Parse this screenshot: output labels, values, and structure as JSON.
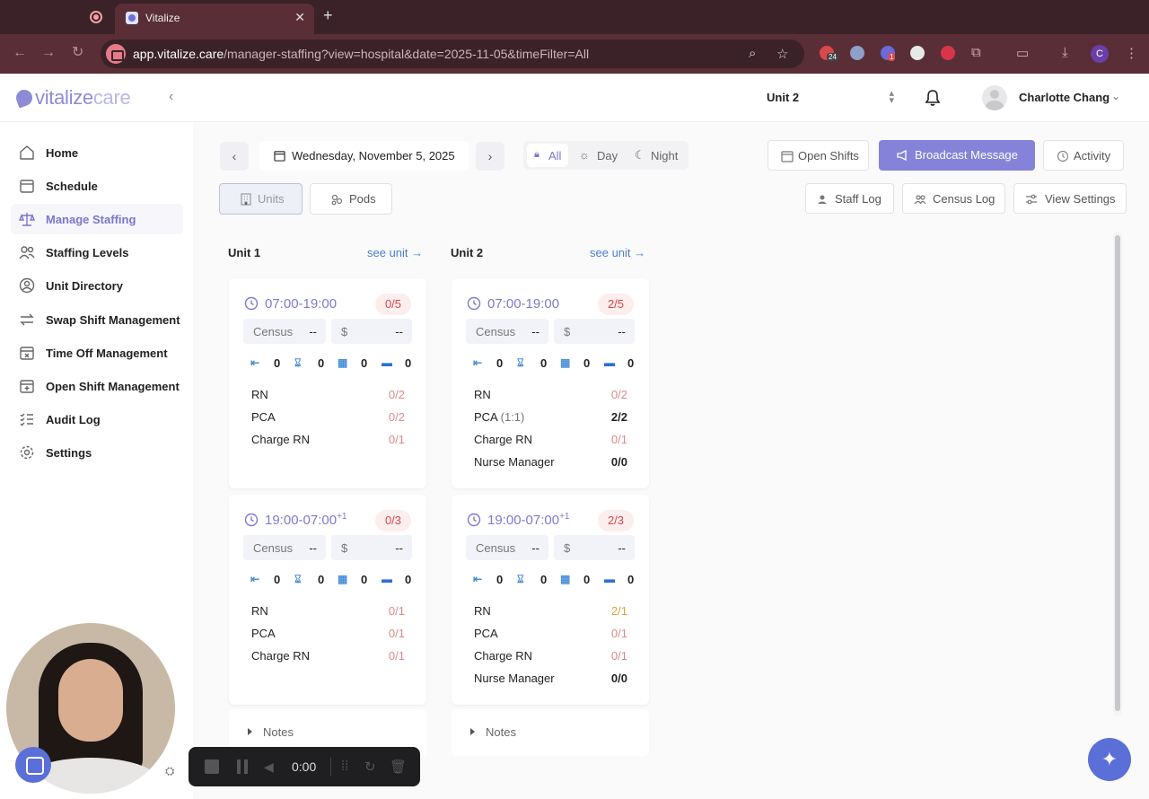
{
  "browser": {
    "tab_title": "Vitalize",
    "url_host": "app.vitalize.care",
    "url_path": "/manager-staffing?view=hospital&date=2025-11-05&timeFilter=All",
    "ext_badge_1": "24",
    "ext_badge_2": "1",
    "profile_letter": "C"
  },
  "header": {
    "logo_vitalize": "vitalize",
    "logo_care": "care",
    "unit_select": "Unit 2",
    "user_name": "Charlotte Chang"
  },
  "sidebar": {
    "items": [
      {
        "label": "Home",
        "icon": "home-icon"
      },
      {
        "label": "Schedule",
        "icon": "calendar-icon"
      },
      {
        "label": "Manage Staffing",
        "icon": "scale-icon"
      },
      {
        "label": "Staffing Levels",
        "icon": "people-icon"
      },
      {
        "label": "Unit Directory",
        "icon": "user-circle-icon"
      },
      {
        "label": "Swap Shift Management",
        "icon": "swap-icon"
      },
      {
        "label": "Time Off Management",
        "icon": "calendar-x-icon"
      },
      {
        "label": "Open Shift Management",
        "icon": "calendar-plus-icon"
      },
      {
        "label": "Audit Log",
        "icon": "list-check-icon"
      },
      {
        "label": "Settings",
        "icon": "gear-icon"
      }
    ],
    "active": "Manage Staffing"
  },
  "toolbar": {
    "date": "Wednesday, November 5, 2025",
    "filters": [
      "All",
      "Day",
      "Night"
    ],
    "active_filter": "All",
    "open_shifts": "Open Shifts",
    "broadcast": "Broadcast Message",
    "activity": "Activity",
    "view_units": "Units",
    "view_pods": "Pods",
    "staff_log": "Staff Log",
    "census_log": "Census Log",
    "view_settings": "View Settings"
  },
  "columns": [
    {
      "title": "Unit 1",
      "see_unit": "see unit →",
      "notes": "Notes",
      "shifts": [
        {
          "time": "07:00-19:00",
          "sup": "",
          "count": "0/5",
          "census_label": "Census",
          "census_value": "--",
          "cost_label": "$",
          "cost_value": "--",
          "stats": [
            "0",
            "0",
            "0",
            "0"
          ],
          "roles": [
            {
              "name": "RN",
              "sub": "",
              "value": "0/2",
              "tone": "red"
            },
            {
              "name": "PCA",
              "sub": "",
              "value": "0/2",
              "tone": "red"
            },
            {
              "name": "Charge RN",
              "sub": "",
              "value": "0/1",
              "tone": "red"
            }
          ]
        },
        {
          "time": "19:00-07:00",
          "sup": "+1",
          "count": "0/3",
          "census_label": "Census",
          "census_value": "--",
          "cost_label": "$",
          "cost_value": "--",
          "stats": [
            "0",
            "0",
            "0",
            "0"
          ],
          "roles": [
            {
              "name": "RN",
              "sub": "",
              "value": "0/1",
              "tone": "red"
            },
            {
              "name": "PCA",
              "sub": "",
              "value": "0/1",
              "tone": "red"
            },
            {
              "name": "Charge RN",
              "sub": "",
              "value": "0/1",
              "tone": "red"
            }
          ]
        }
      ]
    },
    {
      "title": "Unit 2",
      "see_unit": "see unit →",
      "notes": "Notes",
      "shifts": [
        {
          "time": "07:00-19:00",
          "sup": "",
          "count": "2/5",
          "census_label": "Census",
          "census_value": "--",
          "cost_label": "$",
          "cost_value": "--",
          "stats": [
            "0",
            "0",
            "0",
            "0"
          ],
          "roles": [
            {
              "name": "RN",
              "sub": "",
              "value": "0/2",
              "tone": "red"
            },
            {
              "name": "PCA",
              "sub": "(1:1)",
              "value": "2/2",
              "tone": "black"
            },
            {
              "name": "Charge RN",
              "sub": "",
              "value": "0/1",
              "tone": "red"
            },
            {
              "name": "Nurse Manager",
              "sub": "",
              "value": "0/0",
              "tone": "black"
            }
          ]
        },
        {
          "time": "19:00-07:00",
          "sup": "+1",
          "count": "2/3",
          "census_label": "Census",
          "census_value": "--",
          "cost_label": "$",
          "cost_value": "--",
          "stats": [
            "0",
            "0",
            "0",
            "0"
          ],
          "roles": [
            {
              "name": "RN",
              "sub": "",
              "value": "2/1",
              "tone": "amber"
            },
            {
              "name": "PCA",
              "sub": "",
              "value": "0/1",
              "tone": "red"
            },
            {
              "name": "Charge RN",
              "sub": "",
              "value": "0/1",
              "tone": "red"
            },
            {
              "name": "Nurse Manager",
              "sub": "",
              "value": "0/0",
              "tone": "black"
            }
          ]
        }
      ]
    }
  ],
  "recorder": {
    "time": "0:00"
  },
  "colors": {
    "accent": "#8583d9",
    "danger": "#d24848",
    "link": "#4a7fd0"
  }
}
